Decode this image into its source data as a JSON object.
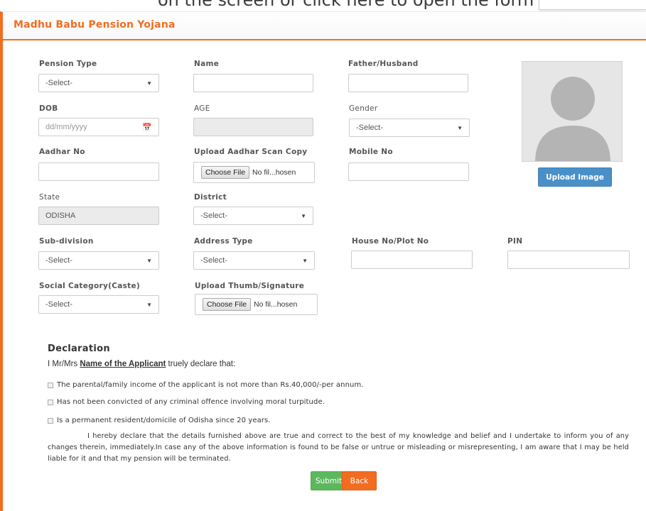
{
  "banner": {
    "text": "on the screen or click here to open the form and"
  },
  "form_title": "Madhu Babu Pension Yojana",
  "fields": {
    "pension_type": {
      "label": "Pension Type",
      "value": "-Select-"
    },
    "name": {
      "label": "Name",
      "value": ""
    },
    "father_husband": {
      "label": "Father/Husband",
      "value": ""
    },
    "dob": {
      "label": "DOB",
      "placeholder": "dd/mm/yyyy"
    },
    "age": {
      "label": "AGE",
      "value": ""
    },
    "gender": {
      "label": "Gender",
      "value": "-Select-"
    },
    "aadhar_no": {
      "label": "Aadhar No",
      "value": ""
    },
    "aadhar_scan": {
      "label": "Upload Aadhar Scan Copy",
      "button": "Choose File",
      "status": "No fil...hosen"
    },
    "mobile_no": {
      "label": "Mobile No",
      "value": ""
    },
    "state": {
      "label": "State",
      "value": "ODISHA"
    },
    "district": {
      "label": "District",
      "value": "-Select-"
    },
    "sub_division": {
      "label": "Sub-division",
      "value": "-Select-"
    },
    "address_type": {
      "label": "Address Type",
      "value": "-Select-"
    },
    "house_no": {
      "label": "House No/Plot No",
      "value": ""
    },
    "pin": {
      "label": "PIN",
      "value": ""
    },
    "social_category": {
      "label": "Social Category(Caste)",
      "value": "-Select-"
    },
    "thumb_signature": {
      "label": "Upload Thumb/Signature",
      "button": "Choose File",
      "status": "No fil...hosen"
    }
  },
  "photo": {
    "upload_label": "Upload Image"
  },
  "declaration": {
    "title": "Declaration",
    "intro_prefix": "I Mr/Mrs",
    "applicant_name": "Name of the Applicant",
    "intro_suffix": "truely declare that:",
    "items": [
      "The parental/family income of the applicant is not more than Rs.40,000/-per annum.",
      "Has not been convicted of any criminal offence involving moral turpitude.",
      "Is a permanent resident/domicile of Odisha since 20 years."
    ],
    "paragraph": "I hereby declare that the details furnished above are true and correct to the best of my knowledge and belief and I undertake to inform you of any changes therein, immediately.In case any of the above information is found to be false or untrue or misleading or misrepresenting, I am aware that I may be held liable for it and that my pension will be terminated."
  },
  "actions": {
    "submit": "Submit",
    "back": "Back"
  },
  "colors": {
    "accent": "#f26d21",
    "submit": "#5cb85c",
    "upload": "#4a90c8"
  }
}
